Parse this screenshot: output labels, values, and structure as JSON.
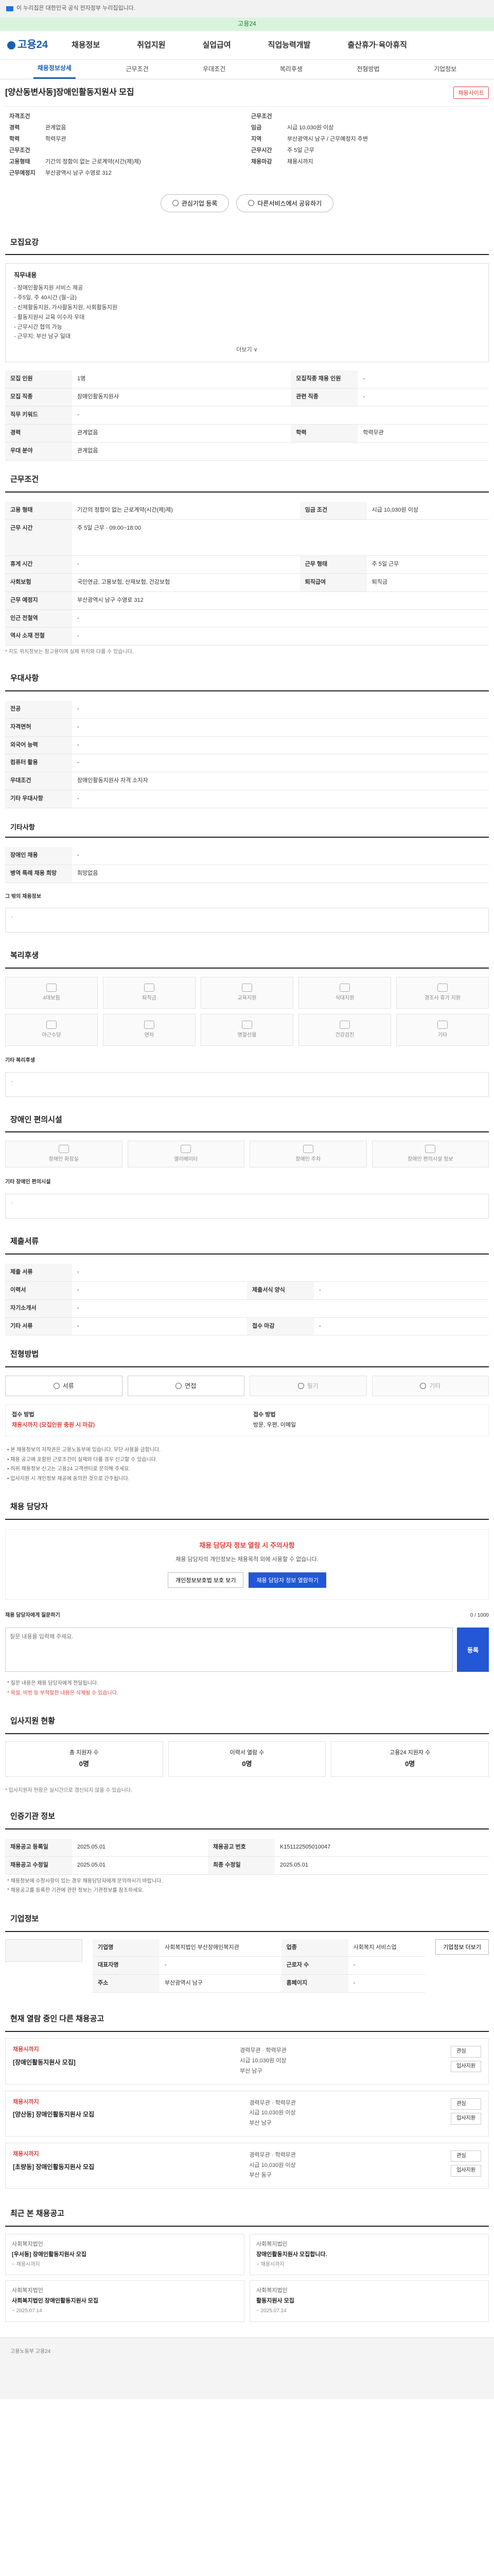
{
  "topbar": {
    "text": "이 누리집은 대한민국 공식 전자정부 누리집입니다."
  },
  "greenbar": {
    "text": "고용24"
  },
  "header": {
    "logo": "고용24",
    "menu": [
      "채용정보",
      "취업지원",
      "실업급여",
      "직업능력개발",
      "출산휴가·육아휴직"
    ]
  },
  "jobtabs": [
    "채용정보상세",
    "근무조건",
    "우대조건",
    "복리후생",
    "전형방법",
    "기업정보"
  ],
  "posting": {
    "title": "[양산동변사동]장애인활동지원사 모집",
    "scrap": "채용사이트",
    "summary_left": [
      {
        "k": "자격조건",
        "v": ""
      },
      {
        "k": "경력",
        "v": "관계없음"
      },
      {
        "k": "학력",
        "v": "학력무관"
      },
      {
        "k": "근무조건",
        "v": ""
      },
      {
        "k": "고용형태",
        "v": "기간의 정함이 없는 근로계약(시간(제)제)"
      },
      {
        "k": "근무예정지",
        "v": "부산광역시 남구 수영로 312"
      }
    ],
    "summary_right": [
      {
        "k": "근무조건",
        "v": ""
      },
      {
        "k": "임금",
        "v": "시급 10,030원 이상"
      },
      {
        "k": "지역",
        "v": "부산광역시 남구 / 근무예정지 주변"
      },
      {
        "k": "근무시간",
        "v": "주 5일 근무"
      },
      {
        "k": "채용마감",
        "v": "채용시까지"
      }
    ],
    "btn_interest": "관심기업 등록",
    "btn_share": "다른서비스에서 공유하기"
  },
  "recruit": {
    "heading": "모집요강",
    "info_title": "직무내용",
    "info_lines": [
      "- 장애인활동지원 서비스 제공",
      "- 주5일, 주 40시간 (월~금)",
      "- 신체활동지원, 가사활동지원, 사회활동지원",
      "- 활동지원사 교육 이수자 우대",
      "- 근무시간 협의 가능",
      "- 근무지: 부산 남구 일대"
    ],
    "info_more": "더보기 ∨",
    "rows": [
      {
        "k": "모집 인원",
        "v": "1명",
        "k2": "모집직종 채용 인원",
        "v2": "-"
      },
      {
        "k": "모집 직종",
        "v": "장애인활동지원사",
        "k2": "관련 직종",
        "v2": "-"
      },
      {
        "k": "직무 키워드",
        "v": "-",
        "k2": "",
        "v2": ""
      },
      {
        "k": "경력",
        "v": "관계없음",
        "k2": "학력",
        "v2": "학력무관"
      },
      {
        "k": "우대 분야",
        "v": "관계없음",
        "k2": "",
        "v2": ""
      }
    ]
  },
  "work": {
    "heading": "근무조건",
    "rows": [
      {
        "k": "고용 형태",
        "v": "기간의 정함이 없는 근로계약(시간(제)제)",
        "k2": "임금 조건",
        "v2": "시급 10,030원 이상"
      },
      {
        "k": "근무 시간",
        "v": "주 5일 근무 · 09:00~18:00",
        "k2": "",
        "v2": ""
      },
      {
        "k": "휴게 시간",
        "v": "-",
        "k2": "근무 형태",
        "v2": "주 5일 근무"
      },
      {
        "k": "사회보험",
        "v": "국민연금, 고용보험, 산재보험, 건강보험",
        "k2": "퇴직급여",
        "v2": "퇴직금"
      },
      {
        "k": "근무 예정지",
        "v": "부산광역시 남구 수영로 312",
        "k2": "",
        "v2": ""
      },
      {
        "k": "인근 전철역",
        "v": "-",
        "k2": "",
        "v2": ""
      },
      {
        "k": "역사 소재 전철",
        "v": "-",
        "k2": "",
        "v2": ""
      }
    ],
    "note": "* 지도 위치정보는 참고용이며 실제 위치와 다를 수 있습니다."
  },
  "prefer": {
    "heading": "우대사항",
    "rows": [
      {
        "k": "전공",
        "v": "-"
      },
      {
        "k": "자격면허",
        "v": "-"
      },
      {
        "k": "외국어 능력",
        "v": "-"
      },
      {
        "k": "컴퓨터 활용",
        "v": "-"
      },
      {
        "k": "우대조건",
        "v": "장애인활동지원사 자격 소지자"
      },
      {
        "k": "기타 우대사항",
        "v": "-"
      }
    ]
  },
  "docs": {
    "heading": "기타사항",
    "rows": [
      {
        "k": "장애인 채용",
        "v": "-"
      },
      {
        "k": "병역 특례 채용 희망",
        "v": "희망없음"
      }
    ],
    "label": "그 밖의 채용정보",
    "text": "-"
  },
  "welfare": {
    "heading": "복리후생",
    "items": [
      "4대보험",
      "퇴직금",
      "교육지원",
      "식대지원",
      "경조사 휴가 지원",
      "야근수당",
      "연차",
      "명절선물",
      "건강검진",
      "기타"
    ],
    "other_label": "기타 복리후생",
    "other_text": "-"
  },
  "disability": {
    "heading": "장애인 편의시설",
    "items": [
      "장애인 화장실",
      "엘리베이터",
      "장애인 주차",
      "장애인 편의시설 정보"
    ],
    "label": "기타 장애인 편의시설",
    "text": "-"
  },
  "doc_submit": {
    "heading": "제출서류",
    "rows": [
      {
        "k": "제출 서류",
        "v": "-",
        "k2": "",
        "v2": ""
      },
      {
        "k": "이력서",
        "v": "-",
        "k2": "제출서식 양식",
        "v2": "-"
      },
      {
        "k": "자기소개서",
        "v": "-",
        "k2": "",
        "v2": ""
      },
      {
        "k": "기타 서류",
        "v": "-",
        "k2": "접수 마감",
        "v2": "-"
      }
    ]
  },
  "method": {
    "heading": "전형방법",
    "items": [
      "서류",
      "면접",
      "필기",
      "기타"
    ],
    "apply_left_label": "접수 방법",
    "apply_left_value": "채용시까지 (모집인원 충원 시 마감)",
    "apply_right_label": "접수 방법",
    "apply_right_value": "방문, 우편, 이메일",
    "bullets": [
      "• 본 채용정보의 저작권은 고용노동부에 있습니다. 무단 사용을 금합니다.",
      "• 채용 공고에 포함된 근로조건이 실제와 다를 경우 신고할 수 있습니다.",
      "• 허위 채용정보 신고는 고용24 고객센터로 문의해 주세요.",
      "• 입사지원 시 개인정보 제공에 동의한 것으로 간주됩니다."
    ]
  },
  "contact": {
    "heading": "채용 담당자",
    "warn_title": "채용 담당자 정보 열람 시 주의사항",
    "warn_desc": "채용 담당자의 개인정보는 채용목적 외에 사용할 수 없습니다.",
    "btn_view": "개인정보보호법 보호 보기",
    "btn_open": "채용 담당자 정보 열람하기",
    "qa_label": "채용 담당자에게 질문하기",
    "qa_placeholder": "질문 내용을 입력해 주세요.",
    "qa_button": "등록",
    "qa_note": "0 / 1000",
    "bullets": [
      "* 질문 내용은 채용 담당자에게 전달됩니다.",
      "* 욕설, 비방 등 부적절한 내용은 삭제될 수 있습니다."
    ]
  },
  "stats": {
    "heading": "입사지원 현황",
    "items": [
      {
        "label": "총 지원자 수",
        "value": "0명"
      },
      {
        "label": "이력서 열람 수",
        "value": "0명"
      },
      {
        "label": "고용24 지원자 수",
        "value": "0명"
      }
    ],
    "note": "* 입사지원자 현황은 실시간으로 갱신되지 않을 수 있습니다."
  },
  "etc_info": {
    "heading": "인증기관 정보",
    "rows": [
      {
        "k": "채용공고 등록일",
        "v": "2025.05.01",
        "k2": "채용공고 번호",
        "v2": "K151122505010047"
      },
      {
        "k": "채용공고 수정일",
        "v": "2025.05.01",
        "k2": "최종 수정일",
        "v2": "2025.05.01"
      }
    ],
    "notes": [
      "* 채용정보에 수정사항이 있는 경우 채용담당자에게 문의하시기 바랍니다.",
      "* 채용공고를 등록한 기관에 관한 정보는 기관정보를 참조하세요."
    ]
  },
  "company": {
    "heading": "기업정보",
    "btn": "기업정보 더보기",
    "rows": [
      {
        "k": "기업명",
        "v": "사회복지법인 부산장애인복지관",
        "k2": "업종",
        "v2": "사회복지 서비스업"
      },
      {
        "k": "대표자명",
        "v": "-",
        "k2": "근로자 수",
        "v2": "-"
      },
      {
        "k": "주소",
        "v": "부산광역시 남구",
        "k2": "홈페이지",
        "v2": "-"
      }
    ]
  },
  "related": {
    "heading": "현재 열람 중인 다른 채용공고",
    "items": [
      {
        "org": "채용시까지",
        "title": "[장애인활동지원사 모집]",
        "meta": [
          "경력무관 · 학력무관",
          "시급 10,030원 이상",
          "부산 남구"
        ]
      },
      {
        "org": "채용시까지",
        "title": "[양산동] 장애인활동지원사 모집",
        "meta": [
          "경력무관 · 학력무관",
          "시급 10,030원 이상",
          "부산 남구"
        ]
      },
      {
        "org": "채용시까지",
        "title": "[초량동] 장애인활동지원사 모집",
        "meta": [
          "경력무관 · 학력무관",
          "시급 10,030원 이상",
          "부산 동구"
        ]
      }
    ],
    "act_scrap": "관심",
    "act_apply": "입사지원"
  },
  "recent": {
    "heading": "최근 본 채용공고",
    "items": [
      {
        "org": "사회복지법인",
        "title": "[우서동] 장애인활동지원사 모집",
        "date": "~ 채용시까지"
      },
      {
        "org": "사회복지법인",
        "title": "장애인활동지원사 모집합니다.",
        "date": "~ 채용시까지"
      },
      {
        "org": "사회복지법인",
        "title": "사회복지법인 장애인활동지원사 모집",
        "date": "~ 2025.07.14"
      },
      {
        "org": "사회복지법인",
        "title": "활동지원사 모집",
        "date": "~ 2025.07.14"
      }
    ]
  },
  "footer": {
    "text": "고용노동부 고용24"
  }
}
